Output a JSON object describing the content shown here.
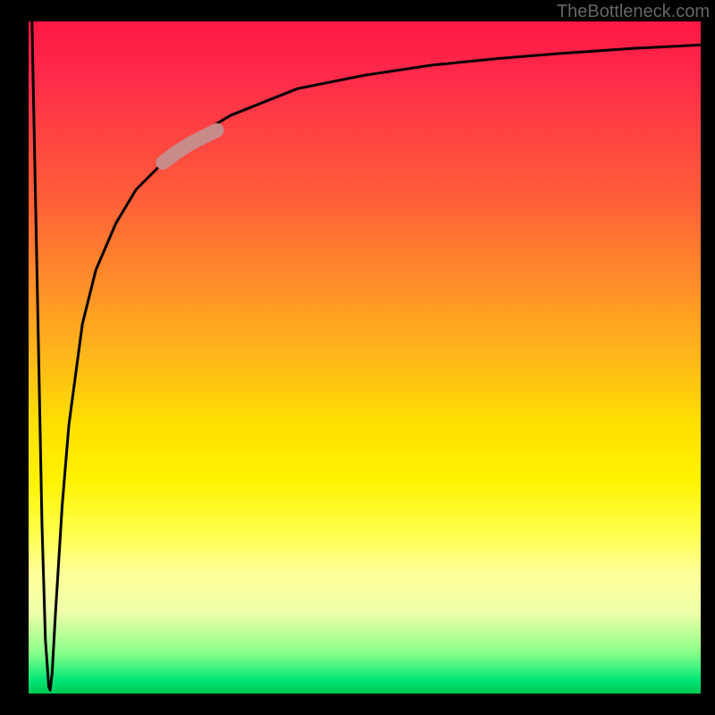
{
  "watermark": "TheBottleneck.com",
  "chart_data": {
    "type": "line",
    "title": "",
    "xlabel": "",
    "ylabel": "",
    "xlim": [
      0,
      100
    ],
    "ylim": [
      0,
      100
    ],
    "grid": false,
    "legend": false,
    "plot_background": "vertical-gradient red→orange→yellow→green",
    "series": [
      {
        "name": "bottleneck-curve",
        "color": "#000000",
        "x": [
          0.5,
          1.0,
          1.5,
          2.0,
          2.5,
          3.0,
          3.2,
          3.5,
          4.0,
          5.0,
          6.0,
          8.0,
          10,
          13,
          16,
          20,
          25,
          30,
          35,
          40,
          50,
          60,
          70,
          80,
          90,
          100
        ],
        "y": [
          100,
          75,
          50,
          25,
          8,
          1,
          0.5,
          3,
          12,
          28,
          40,
          55,
          63,
          70,
          75,
          79,
          83,
          86,
          88,
          90,
          92,
          93.5,
          94.5,
          95.3,
          96,
          96.5
        ]
      },
      {
        "name": "highlight-segment",
        "color": "#c98a8a",
        "thick": true,
        "x": [
          20,
          22,
          24,
          26,
          28
        ],
        "y": [
          79,
          80.5,
          81.8,
          82.8,
          83.8
        ]
      }
    ],
    "annotations": []
  }
}
